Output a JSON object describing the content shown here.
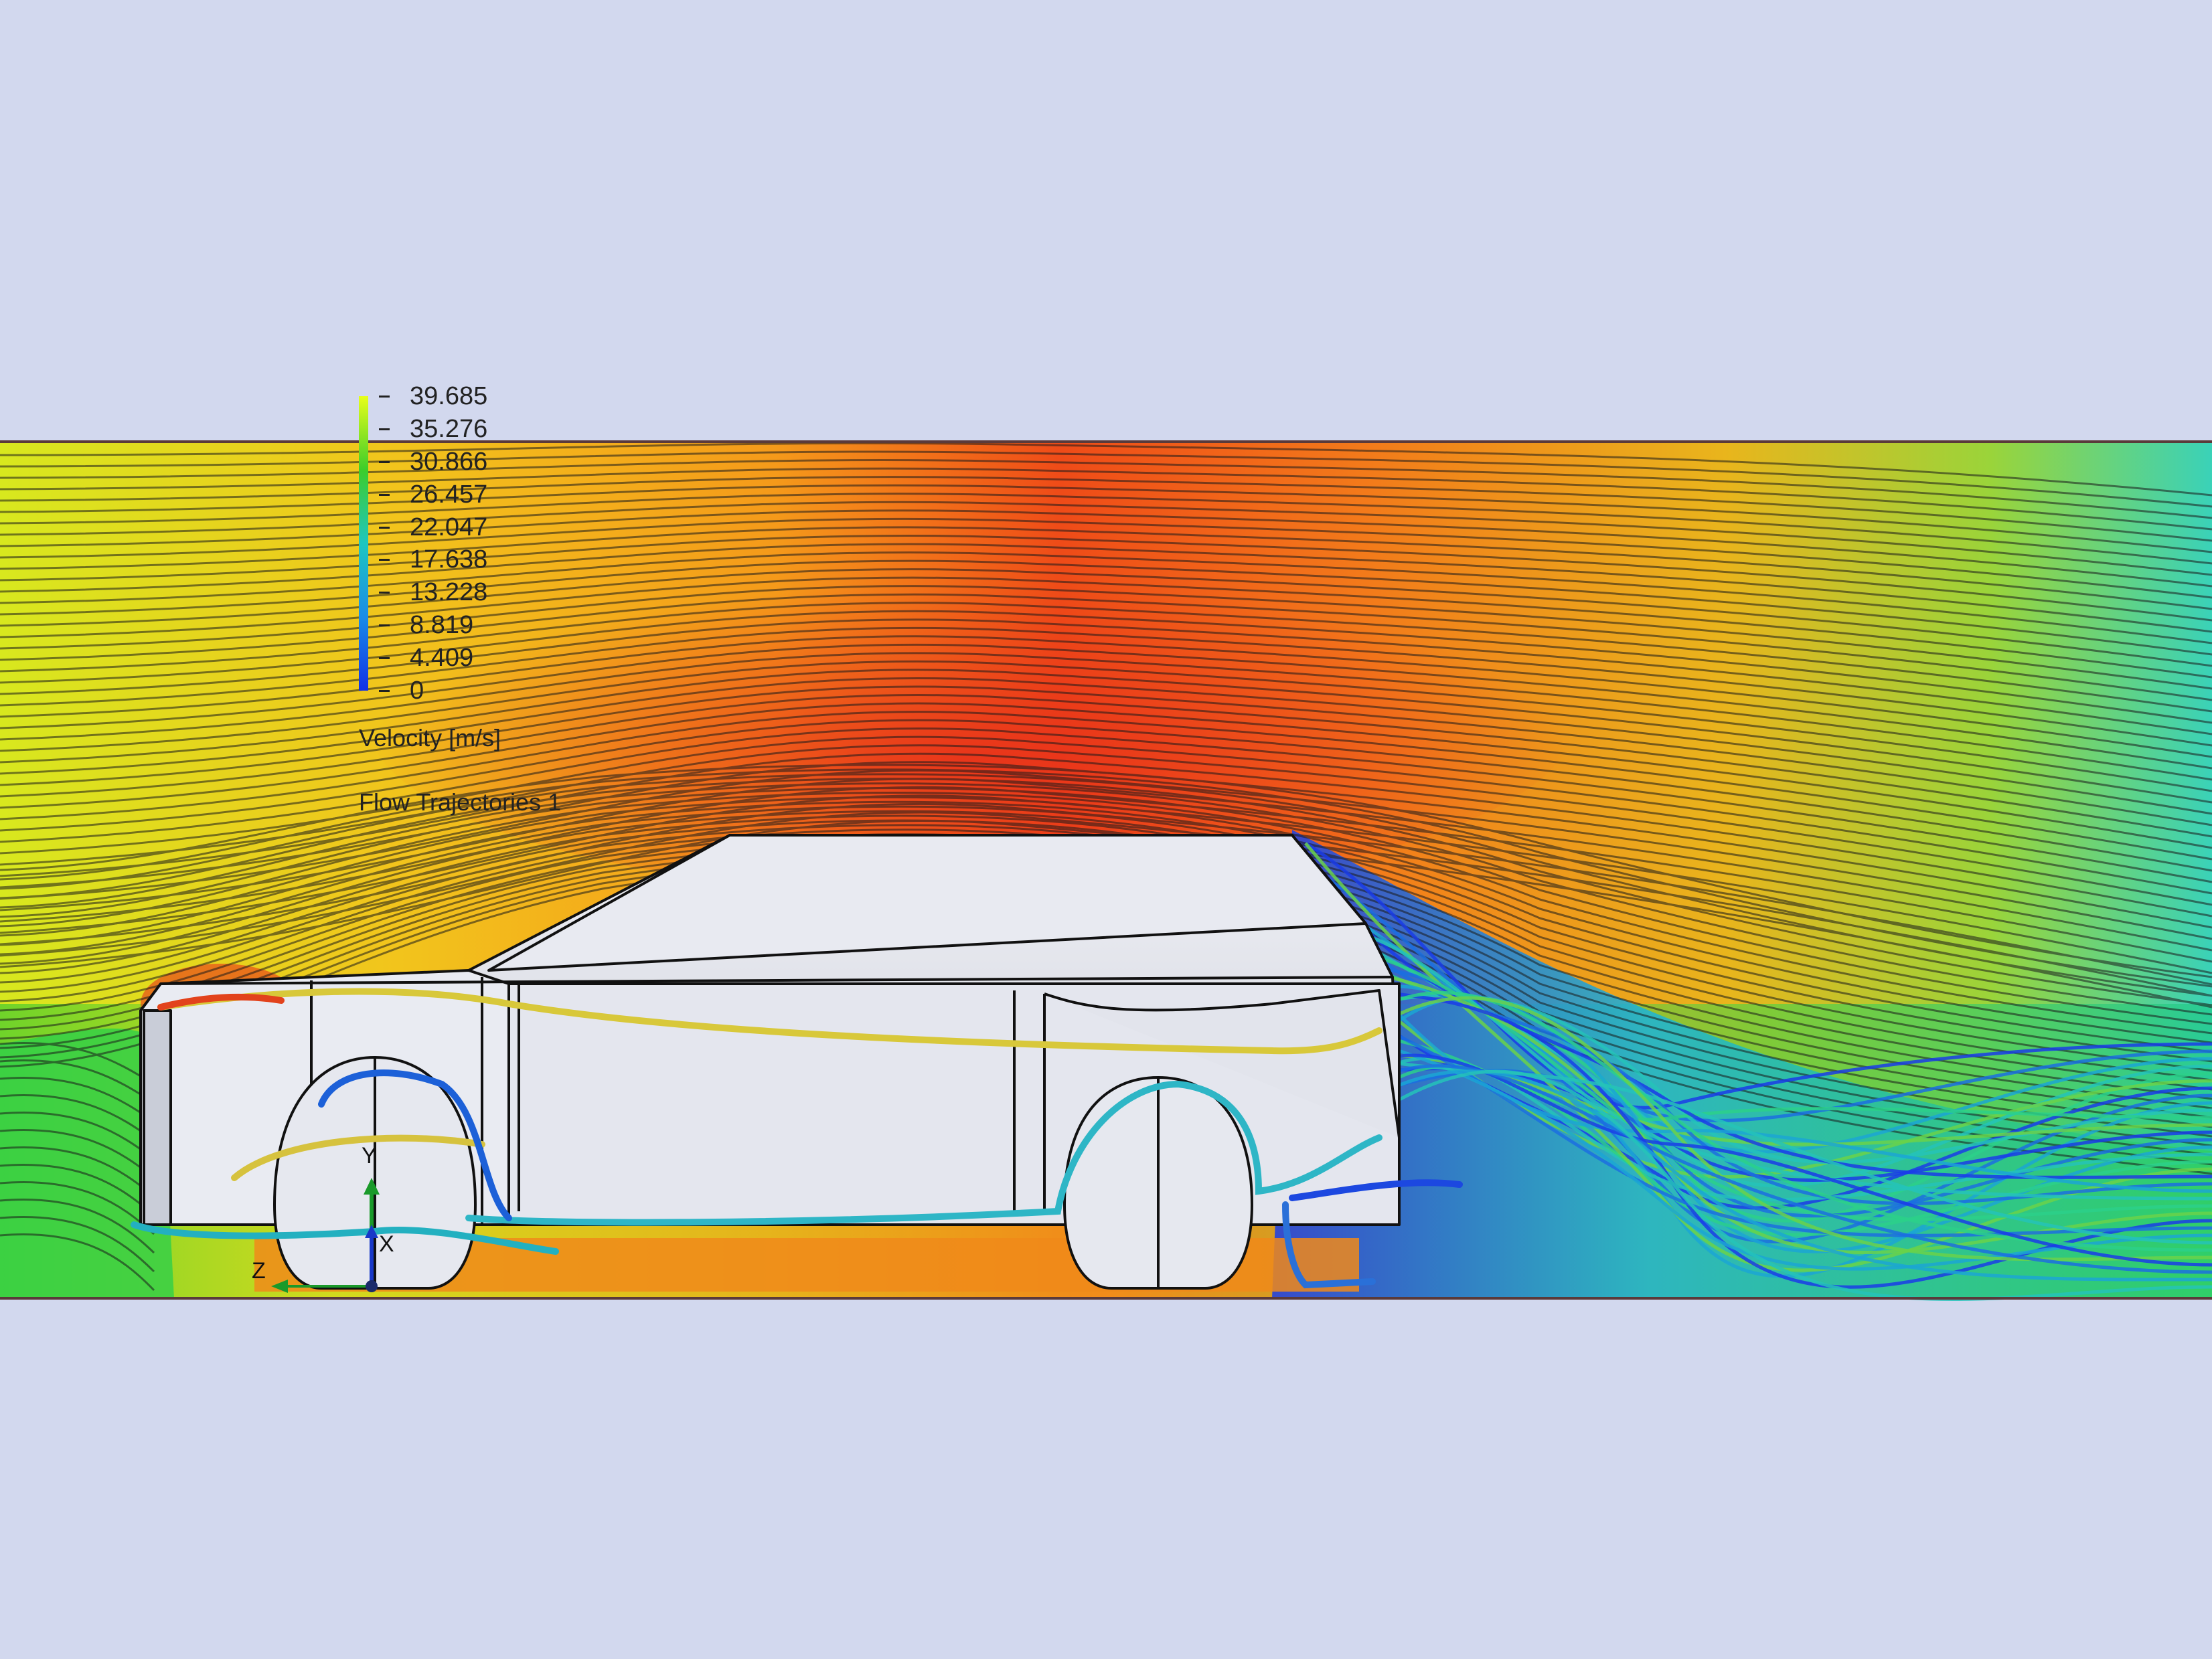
{
  "legend": {
    "ticks": [
      "39.685",
      "35.276",
      "30.866",
      "26.457",
      "22.047",
      "17.638",
      "13.228",
      "8.819",
      "4.409",
      "0"
    ],
    "quantity": "Velocity [m/s]"
  },
  "plot_caption": "Flow Trajectories 1",
  "triad": {
    "x_label": "X",
    "y_label": "Y",
    "z_label": "Z"
  },
  "colors": {
    "background": "#d2d8ee",
    "body": "#e6e8ef",
    "body_shade": "#c9cdd8",
    "outline": "#111111",
    "scale_max": "#e8ff1a",
    "scale_high": "#3ccd2a",
    "scale_mid": "#1ec6e0",
    "scale_low": "#1030e8"
  }
}
